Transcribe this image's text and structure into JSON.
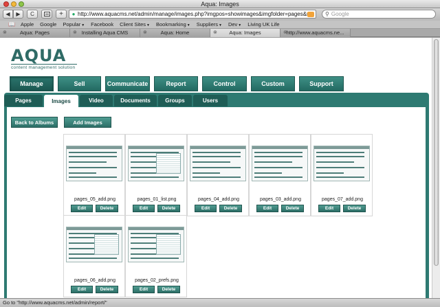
{
  "window": {
    "title": "Aqua: Images"
  },
  "toolbar": {
    "back_label": "◀",
    "forward_label": "▶",
    "reload_label": "C",
    "plus_label": "+",
    "url": "http://www.aquacms.net/admin/manage/images.php?imgpos=showimages&imgfolder=pages&rebuild",
    "search_placeholder": "Google"
  },
  "bookmarks": [
    "Apple",
    "Google",
    "Popular",
    "Facebook",
    "Client Sites",
    "Bookmarking",
    "Suppliers",
    "Dev",
    "Living UK Life"
  ],
  "bookmark_has_menu": [
    false,
    false,
    true,
    false,
    true,
    true,
    true,
    true,
    false
  ],
  "tabs": [
    {
      "label": "Aqua: Pages",
      "active": false
    },
    {
      "label": "Installing Aqua CMS",
      "active": false
    },
    {
      "label": "Aqua: Home",
      "active": false
    },
    {
      "label": "Aqua: Images",
      "active": true
    },
    {
      "label": "http://www.aquacms.ne...",
      "active": false
    }
  ],
  "logo": {
    "word": "AQUA",
    "tagline": "content management solution"
  },
  "main_nav": [
    {
      "label": "Manage",
      "active": true
    },
    {
      "label": "Sell",
      "active": false
    },
    {
      "label": "Communicate",
      "active": false
    },
    {
      "label": "Report",
      "active": false
    },
    {
      "label": "Control",
      "active": false
    },
    {
      "label": "Custom",
      "active": false
    },
    {
      "label": "Support",
      "active": false
    }
  ],
  "sub_nav": [
    {
      "label": "Pages",
      "active": false
    },
    {
      "label": "Images",
      "active": true
    },
    {
      "label": "Video",
      "active": false
    },
    {
      "label": "Documents",
      "active": false
    },
    {
      "label": "Groups",
      "active": false
    },
    {
      "label": "Users",
      "active": false
    }
  ],
  "actions": {
    "back_label": "Back to Albums",
    "add_label": "Add Images"
  },
  "images": [
    {
      "filename": "pages_05_add.png",
      "edit": "Edit",
      "delete": "Delete"
    },
    {
      "filename": "pages_01_list.png",
      "edit": "Edit",
      "delete": "Delete"
    },
    {
      "filename": "pages_04_add.png",
      "edit": "Edit",
      "delete": "Delete"
    },
    {
      "filename": "pages_03_add.png",
      "edit": "Edit",
      "delete": "Delete"
    },
    {
      "filename": "pages_07_add.png",
      "edit": "Edit",
      "delete": "Delete"
    },
    {
      "filename": "pages_06_add.png",
      "edit": "Edit",
      "delete": "Delete"
    },
    {
      "filename": "pages_02_prefs.png",
      "edit": "Edit",
      "delete": "Delete"
    }
  ],
  "status": {
    "text": "Go to \"http://www.aquacms.net/admin/report/\""
  },
  "colors": {
    "brand": "#2f6b66",
    "nav": "#2e7a72"
  }
}
